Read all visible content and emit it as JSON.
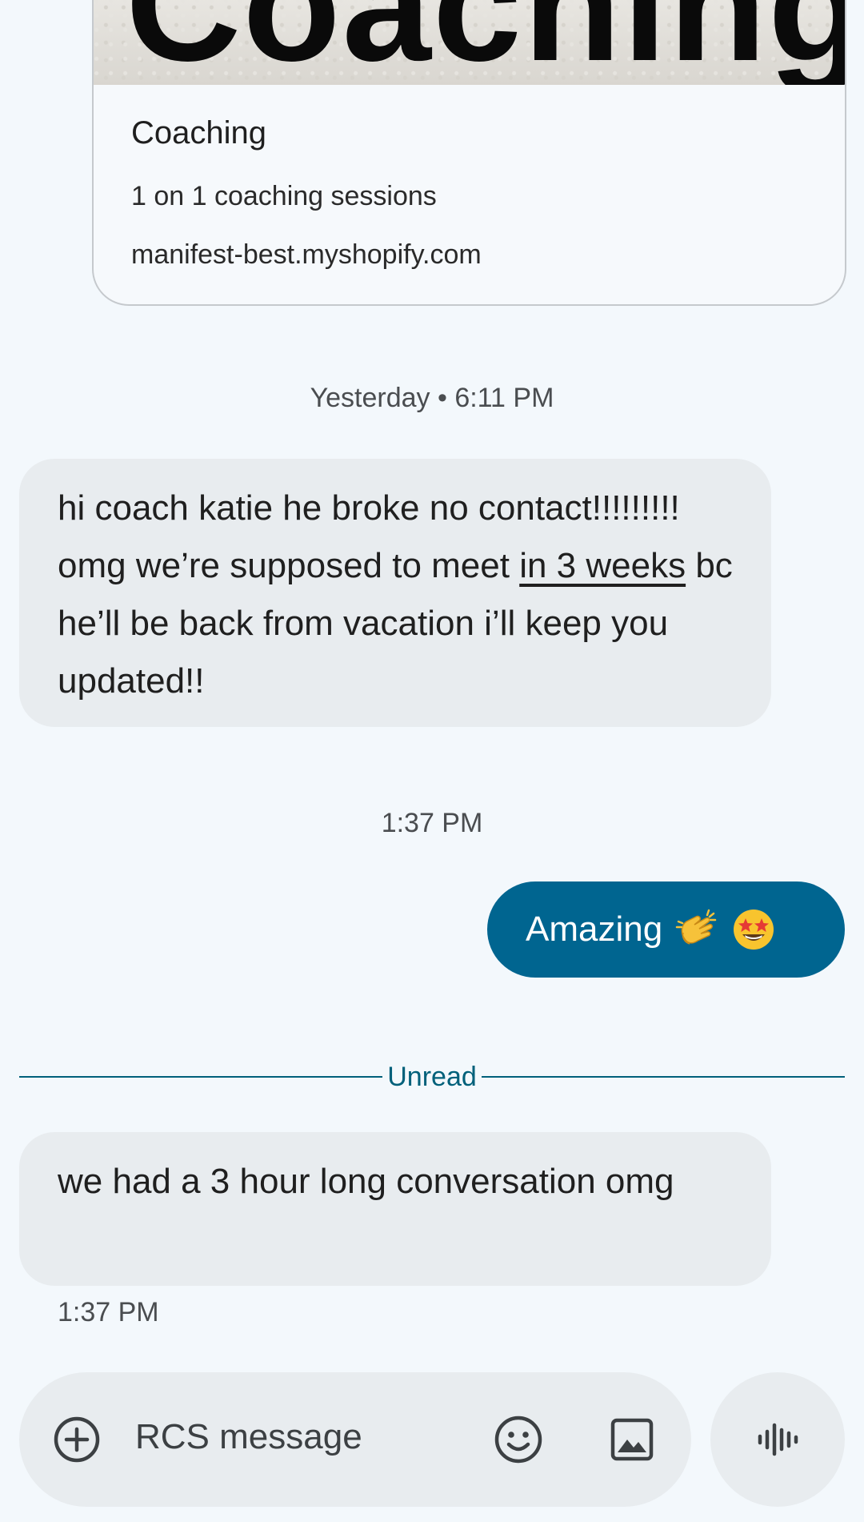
{
  "link_preview": {
    "image_text": "Coaching",
    "title": "Coaching",
    "description": "1 on 1 coaching sessions",
    "domain": "manifest-best.myshopify.com"
  },
  "conversation": {
    "timestamp_1": "Yesterday • 6:11 PM",
    "incoming_1_parts": {
      "before": "hi coach katie he broke no contact!!!!!!!!! omg we’re supposed to meet ",
      "link": "in 3 weeks",
      "after": " bc he’ll be back from vacation i’ll keep you updated!!"
    },
    "timestamp_2": "1:37 PM",
    "outgoing_1": {
      "text": "Amazing",
      "emojis": [
        "clapping-hands-icon",
        "star-struck-face-icon"
      ]
    },
    "unread_label": "Unread",
    "incoming_2": "we had a 3 hour long conversation omg",
    "incoming_2_time": "1:37 PM"
  },
  "compose": {
    "placeholder": "RCS message",
    "icons": [
      "add-icon",
      "emoji-icon",
      "gallery-icon",
      "voice-icon"
    ]
  },
  "colors": {
    "background": "#f3f8fc",
    "incoming_bubble": "#e8ecef",
    "outgoing_bubble": "#006590",
    "accent": "#00607a"
  }
}
